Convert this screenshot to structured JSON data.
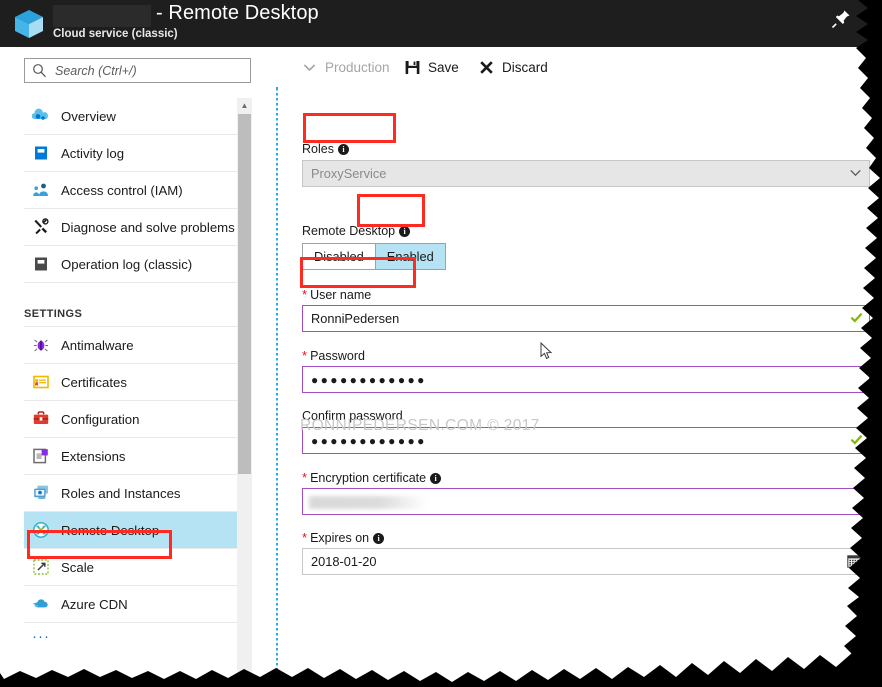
{
  "titlebar": {
    "redacted_name": "",
    "title": "- Remote Desktop",
    "subtitle": "Cloud service (classic)",
    "cube_icon": "cloud-service-cube-icon",
    "pin_icon": "pin-icon"
  },
  "search": {
    "placeholder": "Search (Ctrl+/)",
    "value": "",
    "icon": "search-icon"
  },
  "sidebar": {
    "items": [
      {
        "label": "Overview",
        "icon": "overview-icon",
        "selected": false
      },
      {
        "label": "Activity log",
        "icon": "activity-log-icon",
        "selected": false
      },
      {
        "label": "Access control (IAM)",
        "icon": "access-control-icon",
        "selected": false
      },
      {
        "label": "Diagnose and solve problems",
        "icon": "diagnose-icon",
        "selected": false
      },
      {
        "label": "Operation log (classic)",
        "icon": "operation-log-icon",
        "selected": false
      }
    ],
    "section_header": "SETTINGS",
    "settings_items": [
      {
        "label": "Antimalware",
        "icon": "antimalware-icon",
        "selected": false
      },
      {
        "label": "Certificates",
        "icon": "certificates-icon",
        "selected": false
      },
      {
        "label": "Configuration",
        "icon": "configuration-icon",
        "selected": false
      },
      {
        "label": "Extensions",
        "icon": "extensions-icon",
        "selected": false
      },
      {
        "label": "Roles and Instances",
        "icon": "roles-instances-icon",
        "selected": false
      },
      {
        "label": "Remote Desktop",
        "icon": "remote-desktop-icon",
        "selected": true
      },
      {
        "label": "Scale",
        "icon": "scale-icon",
        "selected": false
      },
      {
        "label": "Azure CDN",
        "icon": "azure-cdn-icon",
        "selected": false
      }
    ],
    "more_dots": "···"
  },
  "toolbar": {
    "production_label": "Production",
    "production_icon": "chevron-down-icon",
    "save_label": "Save",
    "save_icon": "save-disk-icon",
    "discard_label": "Discard",
    "discard_icon": "close-x-icon"
  },
  "form": {
    "roles_label": "Roles",
    "roles_value": "ProxyService",
    "remote_desktop_label": "Remote Desktop",
    "toggle_disabled": "Disabled",
    "toggle_enabled": "Enabled",
    "toggle_selected": "Enabled",
    "username_label": "User name",
    "username_value": "RonniPedersen",
    "password_label": "Password",
    "password_value": "●●●●●●●●●●●●",
    "confirm_password_label": "Confirm password",
    "confirm_password_value": "●●●●●●●●●●●●",
    "encryption_certificate_label": "Encryption certificate",
    "encryption_certificate_value": "",
    "expires_on_label": "Expires on",
    "expires_on_value": "2018-01-20",
    "calendar_icon": "calendar-icon",
    "valid_icon": "green-check-icon"
  },
  "watermark": "RONNIPEDERSEN.COM © 2017",
  "colors": {
    "accent_blue": "#0078d7",
    "selection_cyan": "#b5e3f3",
    "annotation_red": "#ff2a20",
    "field_purple": "#a24fc4",
    "required_red": "#e81123",
    "valid_green": "#7fba00",
    "titlebar_dark": "#1e1e1e"
  }
}
